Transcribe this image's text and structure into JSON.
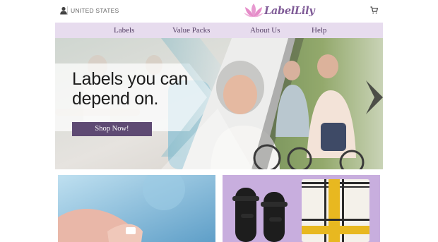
{
  "topbar": {
    "country": "UNITED STATES",
    "logo_text": "LabelLily",
    "icons": {
      "account": "user-icon",
      "cart": "cart-icon",
      "logo_mark": "lotus-icon"
    }
  },
  "nav": {
    "items": [
      {
        "label": "Labels"
      },
      {
        "label": "Value Packs"
      },
      {
        "label": "About Us"
      },
      {
        "label": "Help"
      }
    ]
  },
  "hero": {
    "headline": "Labels you can depend on.",
    "cta_label": "Shop Now!"
  },
  "colors": {
    "brand": "#7f5b97",
    "nav_bg": "#e7dcee",
    "cta_bg": "#5e4a73",
    "tile_purple": "#c8aede",
    "lotus_pink": "#e79ad0"
  }
}
